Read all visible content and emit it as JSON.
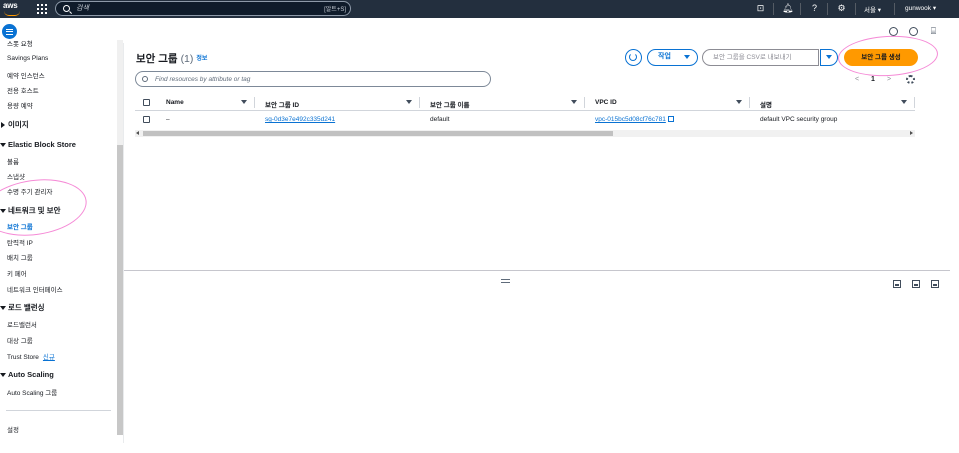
{
  "topbar": {
    "logo_text": "aws",
    "search_placeholder": "검색",
    "search_shortcut": "[알트+S]",
    "region": "서울 ▾",
    "user": "gunwook ▾"
  },
  "sidebar": {
    "items": [
      {
        "id": "spot",
        "label": "스폿 요청",
        "type": "item",
        "top": 0
      },
      {
        "id": "savings",
        "label": "Savings Plans",
        "type": "item"
      },
      {
        "id": "reserved",
        "label": "예약 인스턴스",
        "type": "item"
      },
      {
        "id": "dedicated",
        "label": "전용 호스트",
        "type": "item"
      },
      {
        "id": "capacity",
        "label": "용량 예약",
        "type": "item"
      }
    ],
    "images_header": "이미지",
    "ebs_header": "Elastic Block Store",
    "ebs_items": [
      "볼륨",
      "스냅샷",
      "수명 주기 관리자"
    ],
    "network_header": "네트워크 및 보안",
    "network_items": [
      "보안 그룹",
      "탄력적 IP",
      "배치 그룹",
      "키 페어",
      "네트워크 인터페이스"
    ],
    "lb_header": "로드 밸런싱",
    "lb_items": [
      "로드밸런서",
      "대상 그룹",
      "Trust Store"
    ],
    "lb_new_badge": "신규",
    "asg_header": "Auto Scaling",
    "asg_items": [
      "Auto Scaling 그룹"
    ],
    "settings": "설정"
  },
  "main": {
    "title": "보안 그룹",
    "count": "(1)",
    "info_link": "정보",
    "action_button": "작업",
    "export_button": "보안 그룹을 CSV로 내보내기",
    "create_button": "보안 그룹 생성",
    "filter_placeholder": "Find resources by attribute or tag",
    "pager_prev": "<",
    "pager_page": "1",
    "pager_next": ">"
  },
  "table": {
    "columns": [
      "Name",
      "보안 그룹 ID",
      "보안 그룹 이름",
      "VPC ID",
      "설명"
    ],
    "rows": [
      {
        "name": "–",
        "sg_id": "sg-0d3e7e492c335d241",
        "sg_name": "default",
        "vpc_id": "vpc-015bc5d08cf76c781",
        "description": "default VPC security group"
      }
    ]
  },
  "colors": {
    "topbar_bg": "#232f3e",
    "accent_blue": "#0972d3",
    "create_orange": "#ff9900",
    "annotation_pink": "#f58ad6"
  }
}
